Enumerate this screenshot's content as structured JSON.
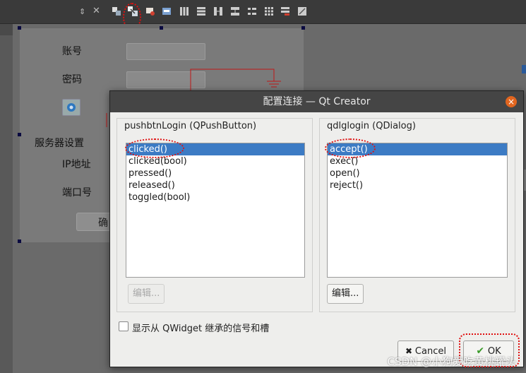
{
  "form": {
    "account_label": "账号",
    "password_label": "密码",
    "server_label": "服务器设置",
    "ip_label": "IP地址",
    "port_label": "端口号",
    "confirm_label": "确"
  },
  "dialog": {
    "title": "配置连接 — Qt Creator",
    "close_glyph": "×",
    "sender": {
      "title": "pushbtnLogin (QPushButton)",
      "signals": [
        "clicked()",
        "clicked(bool)",
        "pressed()",
        "released()",
        "toggled(bool)"
      ],
      "selected_index": 0,
      "edit_label": "编辑..."
    },
    "receiver": {
      "title": "qdlglogin (QDialog)",
      "slots": [
        "accept()",
        "exec()",
        "open()",
        "reject()"
      ],
      "selected_index": 0,
      "edit_label": "编辑..."
    },
    "inherit_checkbox_label": "显示从 QWidget 继承的信号和槽",
    "inherit_checked": false,
    "cancel_label": "Cancel",
    "ok_label": "OK"
  },
  "watermark": "CSDN @小狗爱吃黄桃罐头",
  "colors": {
    "selection": "#3c7bc4",
    "annotation": "#e01010",
    "close": "#e1651f"
  }
}
